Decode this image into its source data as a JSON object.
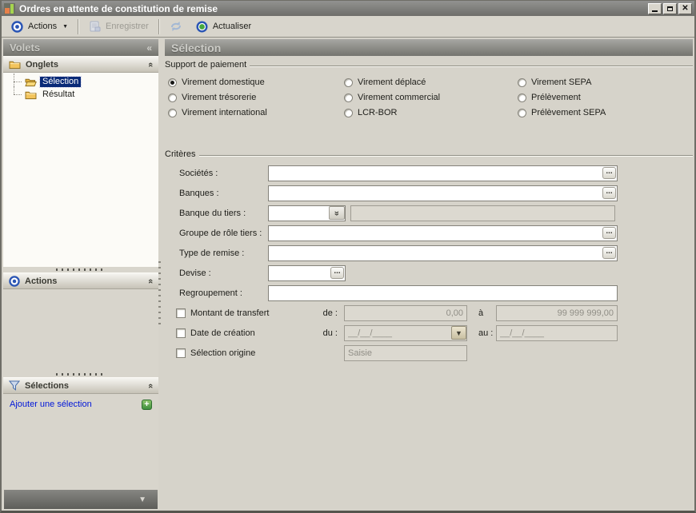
{
  "window": {
    "title": "Ordres en attente de constitution de remise"
  },
  "toolbar": {
    "actions_label": "Actions",
    "save_label": "Enregistrer",
    "refresh_label": "Actualiser"
  },
  "icons": {
    "ellipsis": "...",
    "chevron_double": "«",
    "collapse_left": "«",
    "dropdown_arrow": "▼",
    "plus": "+"
  },
  "sidebar": {
    "header": "Volets",
    "onglets": {
      "title": "Onglets",
      "items": [
        {
          "label": "Sélection",
          "selected": true
        },
        {
          "label": "Résultat",
          "selected": false
        }
      ]
    },
    "actions": {
      "title": "Actions"
    },
    "selections": {
      "title": "Sélections",
      "add_link": "Ajouter une sélection"
    }
  },
  "main": {
    "header": "Sélection",
    "support": {
      "title": "Support de paiement",
      "selected": "Virement domestique",
      "options": [
        "Virement domestique",
        "Virement déplacé",
        "Virement SEPA",
        "Virement trésorerie",
        "Virement commercial",
        "Prélèvement",
        "Virement international",
        "LCR-BOR",
        "Prélèvement SEPA"
      ]
    },
    "criteria": {
      "title": "Critères",
      "societes_label": "Sociétés :",
      "banques_label": "Banques :",
      "banque_tiers_label": "Banque du tiers :",
      "groupe_role_label": "Groupe de rôle tiers :",
      "type_remise_label": "Type de remise :",
      "devise_label": "Devise :",
      "regroupement_label": "Regroupement :",
      "montant": {
        "label": "Montant de transfert",
        "de": "de :",
        "de_value": "0,00",
        "a": "à",
        "a_value": "99 999 999,00",
        "checked": false
      },
      "date": {
        "label": "Date de création",
        "du": "du :",
        "du_value": "__/__/____",
        "au": "au :",
        "au_value": "__/__/____",
        "checked": false
      },
      "origine": {
        "label": "Sélection origine",
        "value": "Saisie",
        "checked": false
      }
    }
  }
}
